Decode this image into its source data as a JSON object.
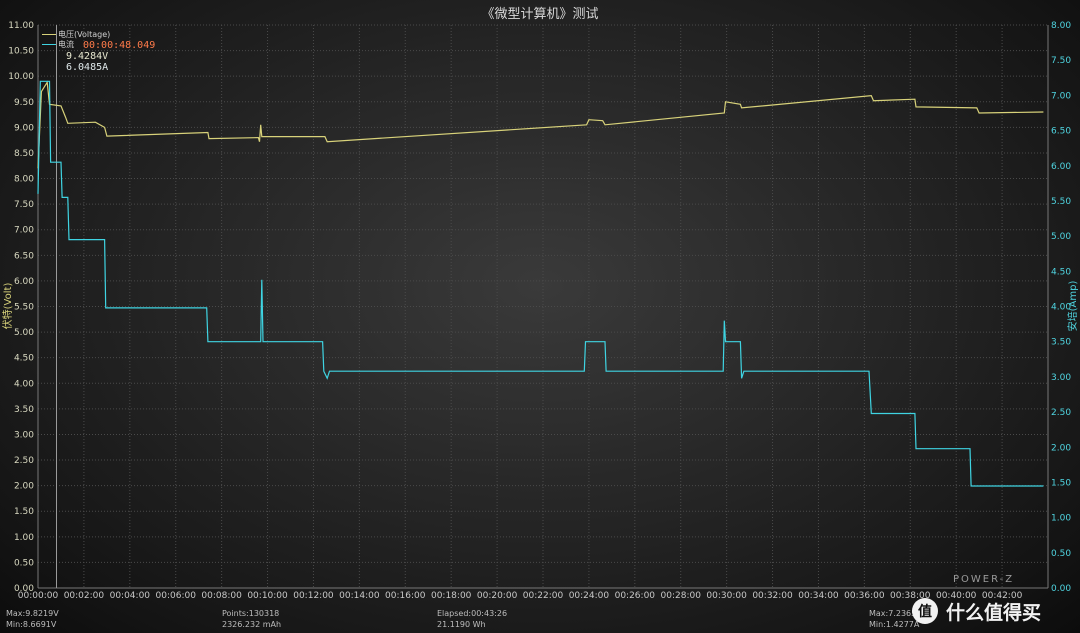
{
  "chart_data": {
    "type": "line",
    "title": "《微型计算机》测试",
    "xlabel": "",
    "ylabel_left": "伏特(Volt)",
    "ylabel_right": "安培(Amp)",
    "x_unit": "minutes",
    "xlim": [
      0,
      44
    ],
    "ylim_left": [
      0,
      11
    ],
    "ylim_right": [
      0,
      8
    ],
    "x_ticks": [
      "00:00:00",
      "00:02:00",
      "00:04:00",
      "00:06:00",
      "00:08:00",
      "00:10:00",
      "00:12:00",
      "00:14:00",
      "00:16:00",
      "00:18:00",
      "00:20:00",
      "00:22:00",
      "00:24:00",
      "00:26:00",
      "00:28:00",
      "00:30:00",
      "00:32:00",
      "00:34:00",
      "00:36:00",
      "00:38:00",
      "00:40:00",
      "00:42:00"
    ],
    "y_ticks_left": [
      "0.00",
      "0.50",
      "1.00",
      "1.50",
      "2.00",
      "2.50",
      "3.00",
      "3.50",
      "4.00",
      "4.50",
      "5.00",
      "5.50",
      "6.00",
      "6.50",
      "7.00",
      "7.50",
      "8.00",
      "8.50",
      "9.00",
      "9.50",
      "10.00",
      "10.50",
      "11.00"
    ],
    "y_ticks_right": [
      "0.00",
      "0.50",
      "1.00",
      "1.50",
      "2.00",
      "2.50",
      "3.00",
      "3.50",
      "4.00",
      "4.50",
      "5.00",
      "5.50",
      "6.00",
      "6.50",
      "7.00",
      "7.50",
      "8.00"
    ],
    "grid": true,
    "legend_position": "top-left",
    "series": [
      {
        "name": "电压(Voltage)",
        "axis": "left",
        "color": "#d8d27a",
        "points": [
          [
            0,
            8.2
          ],
          [
            0.15,
            9.7
          ],
          [
            0.4,
            9.88
          ],
          [
            0.5,
            9.45
          ],
          [
            1.0,
            9.42
          ],
          [
            1.2,
            9.2
          ],
          [
            1.3,
            9.08
          ],
          [
            2.5,
            9.1
          ],
          [
            2.9,
            9.0
          ],
          [
            3.0,
            8.83
          ],
          [
            7.4,
            8.9
          ],
          [
            7.45,
            8.78
          ],
          [
            9.6,
            8.8
          ],
          [
            9.65,
            8.72
          ],
          [
            9.7,
            9.05
          ],
          [
            9.75,
            8.82
          ],
          [
            12.5,
            8.82
          ],
          [
            12.6,
            8.72
          ],
          [
            23.9,
            9.05
          ],
          [
            24.0,
            9.15
          ],
          [
            24.6,
            9.13
          ],
          [
            24.7,
            9.05
          ],
          [
            29.9,
            9.28
          ],
          [
            29.95,
            9.5
          ],
          [
            30.6,
            9.45
          ],
          [
            30.65,
            9.38
          ],
          [
            36.3,
            9.62
          ],
          [
            36.4,
            9.52
          ],
          [
            38.2,
            9.55
          ],
          [
            38.25,
            9.4
          ],
          [
            40.9,
            9.38
          ],
          [
            41.0,
            9.28
          ],
          [
            43.8,
            9.3
          ]
        ]
      },
      {
        "name": "电流",
        "axis": "right",
        "color": "#3fd4e2",
        "points": [
          [
            0,
            5.6
          ],
          [
            0.1,
            7.2
          ],
          [
            0.5,
            7.2
          ],
          [
            0.55,
            6.05
          ],
          [
            1.0,
            6.05
          ],
          [
            1.05,
            5.55
          ],
          [
            1.3,
            5.55
          ],
          [
            1.35,
            4.95
          ],
          [
            2.9,
            4.95
          ],
          [
            2.95,
            3.98
          ],
          [
            7.35,
            3.98
          ],
          [
            7.4,
            3.5
          ],
          [
            9.7,
            3.5
          ],
          [
            9.75,
            4.38
          ],
          [
            9.8,
            3.5
          ],
          [
            12.4,
            3.5
          ],
          [
            12.45,
            3.08
          ],
          [
            12.6,
            2.98
          ],
          [
            12.7,
            3.08
          ],
          [
            23.8,
            3.08
          ],
          [
            23.85,
            3.5
          ],
          [
            24.7,
            3.5
          ],
          [
            24.75,
            3.08
          ],
          [
            29.85,
            3.08
          ],
          [
            29.9,
            3.8
          ],
          [
            29.95,
            3.5
          ],
          [
            30.6,
            3.5
          ],
          [
            30.65,
            2.98
          ],
          [
            30.75,
            3.08
          ],
          [
            36.2,
            3.08
          ],
          [
            36.3,
            2.48
          ],
          [
            38.2,
            2.48
          ],
          [
            38.25,
            1.98
          ],
          [
            40.6,
            1.98
          ],
          [
            40.65,
            1.45
          ],
          [
            43.8,
            1.45
          ]
        ]
      }
    ],
    "cursor": {
      "time": "00:00:48.049",
      "voltage": "9.4284V",
      "current": "6.0485A"
    }
  },
  "legend": {
    "voltage_label": "电压(Voltage)",
    "current_label": "电流"
  },
  "stats": {
    "vmax": "Max:9.8219V",
    "vmin": "Min:8.6691V",
    "points": "Points:130318",
    "mah": "2326.232 mAh",
    "elapsed": "Elapsed:00:43:26",
    "wh": "21.1190 Wh",
    "amax": "Max:7.2365",
    "amin": "Min:1.4277A"
  },
  "brand": "POWER-Z",
  "watermark": "什么值得买",
  "colors": {
    "voltage": "#d8d27a",
    "current": "#3fd4e2",
    "cursor_time": "#ff7b4a"
  }
}
